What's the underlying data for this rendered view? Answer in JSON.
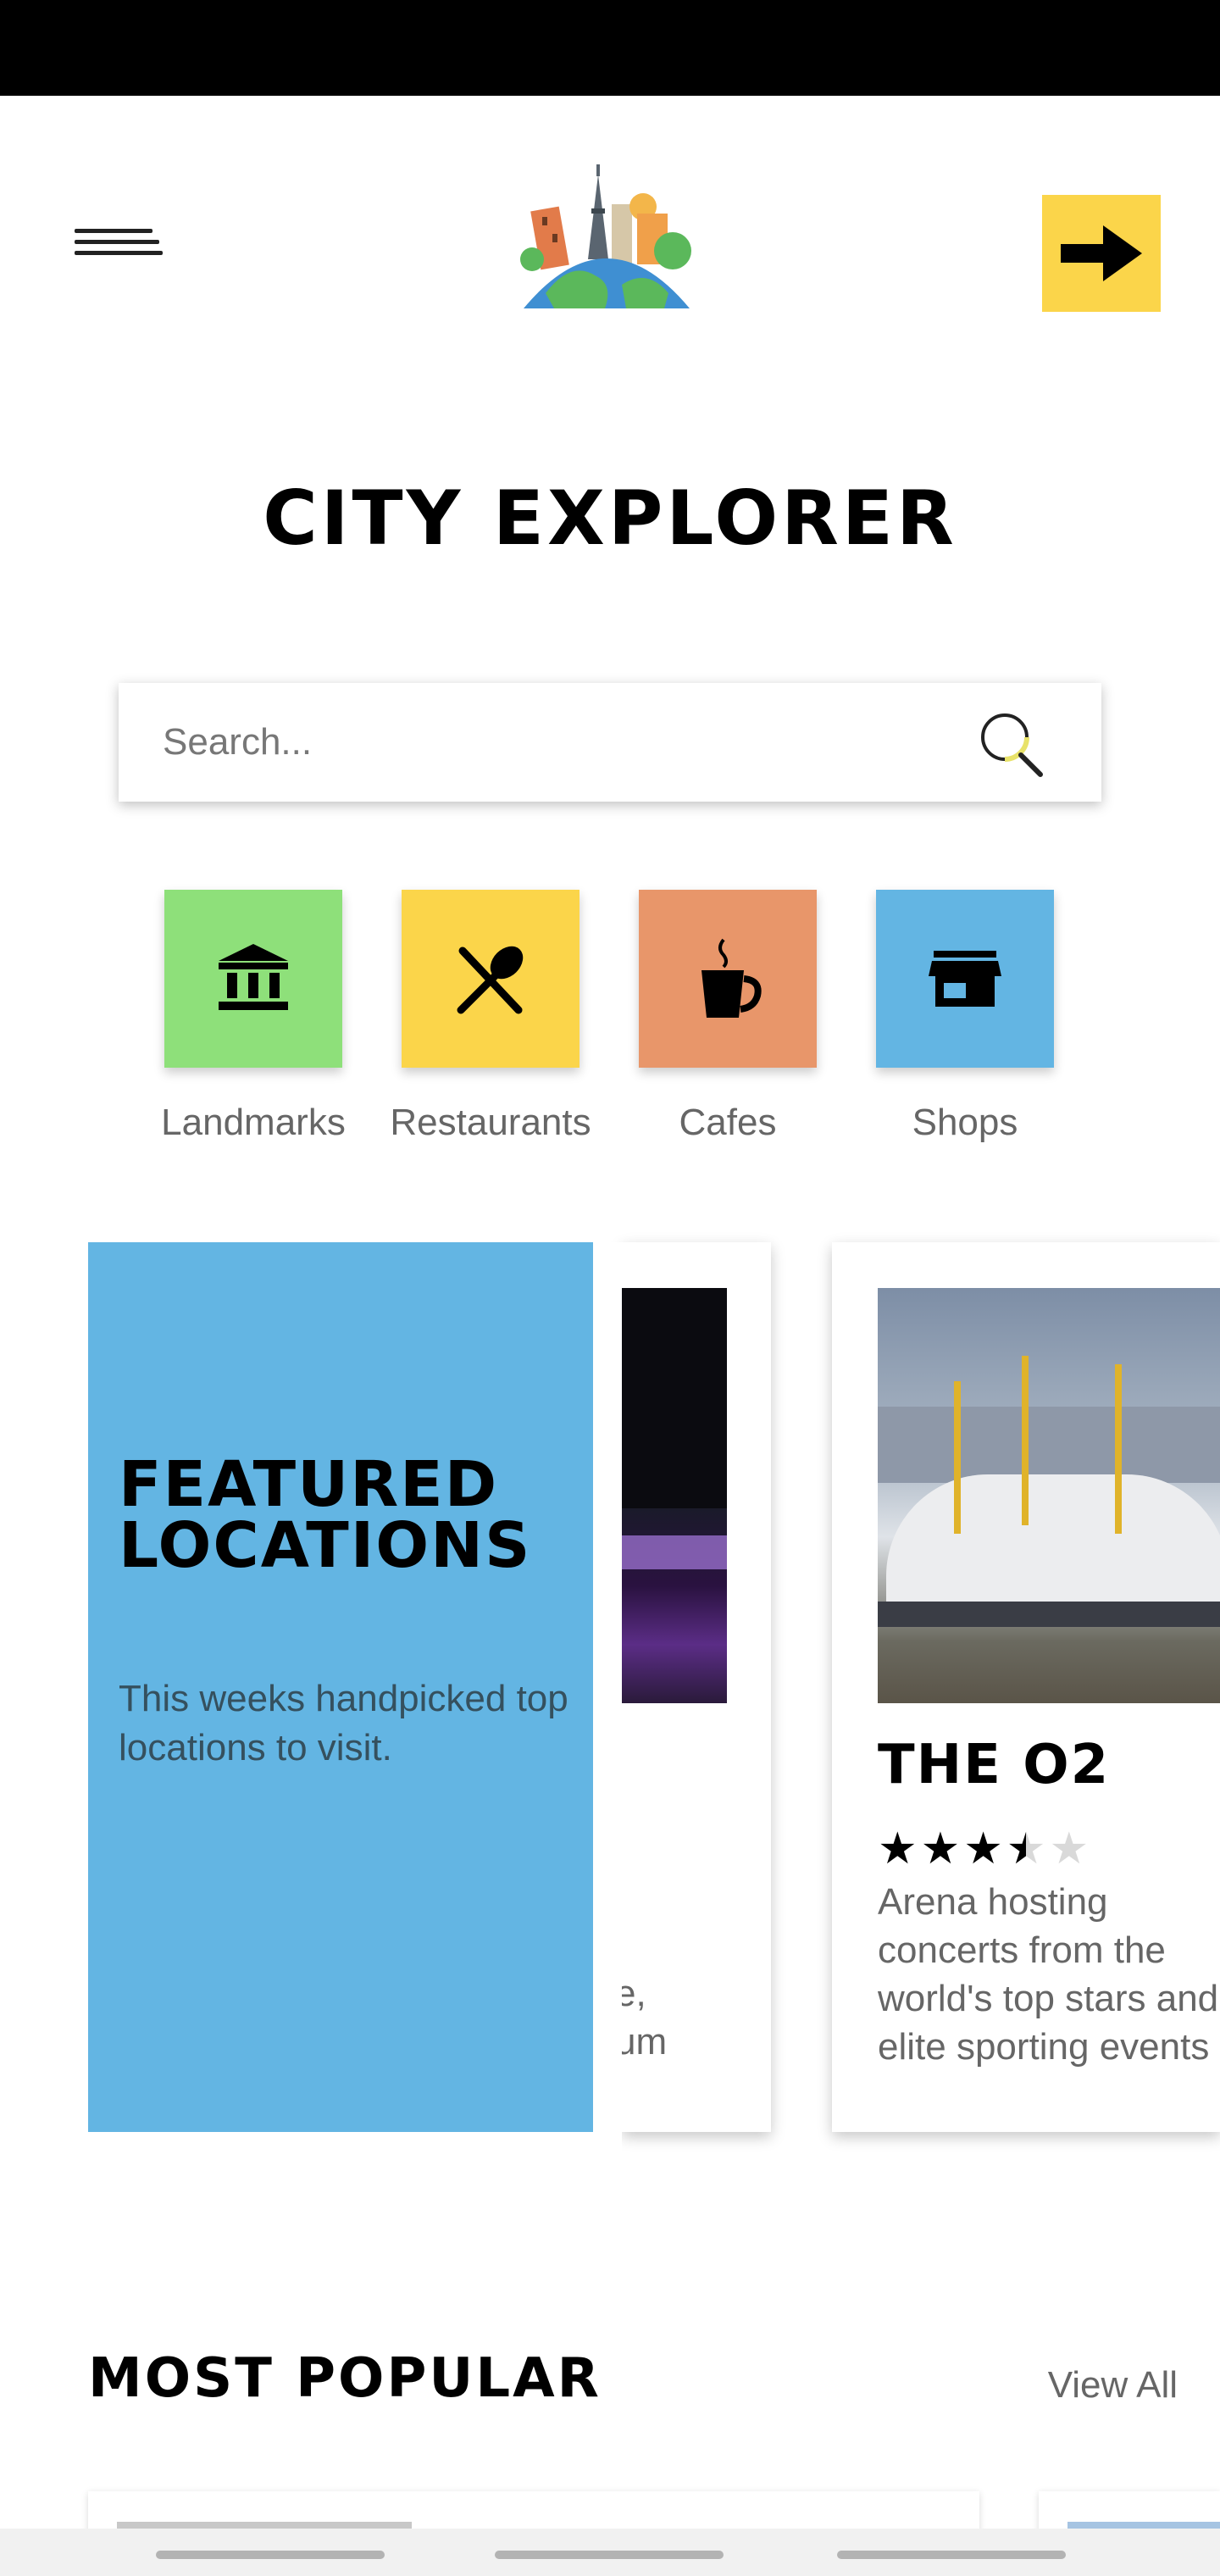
{
  "app": {
    "title": "CITY EXPLORER"
  },
  "header": {
    "menu_icon": "hamburger-menu-icon",
    "logo": "city-globe-logo",
    "action_icon": "arrow-right-icon",
    "action_color": "#fbd54a"
  },
  "search": {
    "placeholder": "Search...",
    "value": "",
    "icon": "search-icon"
  },
  "categories": [
    {
      "label": "Landmarks",
      "icon": "landmark-icon",
      "color": "#8ee07a"
    },
    {
      "label": "Restaurants",
      "icon": "utensils-icon",
      "color": "#fbd54a"
    },
    {
      "label": "Cafes",
      "icon": "coffee-cup-icon",
      "color": "#e8966a"
    },
    {
      "label": "Shops",
      "icon": "storefront-icon",
      "color": "#63b5e3"
    }
  ],
  "featured": {
    "title_line1": "FEATURED",
    "title_line2": "LOCATIONS",
    "subtitle": "This weeks handpicked top locations to visit.",
    "background": "#63b5e3",
    "cards": [
      {
        "desc_line1": "e,",
        "desc_line2": "um"
      },
      {
        "title": "THE O2",
        "rating": 3.5,
        "max_rating": 5,
        "description": "Arena hosting concerts from the world's top stars and elite sporting events"
      }
    ]
  },
  "popular": {
    "title": "MOST POPULAR",
    "view_all": "View All"
  }
}
